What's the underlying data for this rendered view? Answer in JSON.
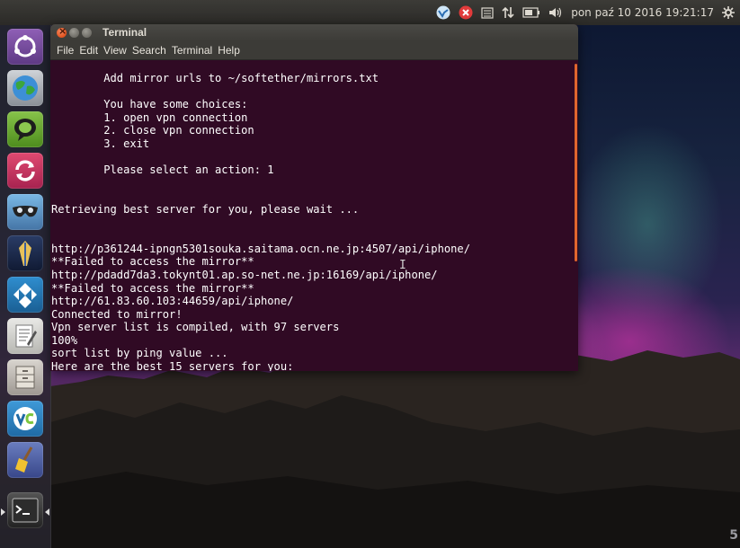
{
  "panel": {
    "tray_icons": [
      "vpn-icon",
      "error-icon",
      "keyboard-icon",
      "network-arrows-icon",
      "battery-icon",
      "volume-icon"
    ],
    "clock": "pon paź 10 2016 19:21:17",
    "settings_icon": "gear-icon"
  },
  "launcher": {
    "items": [
      {
        "name": "dash-icon"
      },
      {
        "name": "globe-browser-icon"
      },
      {
        "name": "chat-bubble-icon"
      },
      {
        "name": "sync-icon"
      },
      {
        "name": "mask-icon"
      },
      {
        "name": "feather-pen-icon"
      },
      {
        "name": "kodi-icon"
      },
      {
        "name": "text-editor-icon"
      },
      {
        "name": "file-cabinet-icon"
      },
      {
        "name": "vnc-icon"
      },
      {
        "name": "broom-icon"
      },
      {
        "name": "terminal-icon"
      }
    ]
  },
  "window": {
    "title": "Terminal",
    "menu": [
      "File",
      "Edit",
      "View",
      "Search",
      "Terminal",
      "Help"
    ]
  },
  "terminal": {
    "lines": [
      "        Add mirror urls to ~/softether/mirrors.txt",
      "",
      "        You have some choices:",
      "        1. open vpn connection",
      "        2. close vpn connection",
      "        3. exit",
      "",
      "        Please select an action: 1",
      "",
      "",
      "Retrieving best server for you, please wait ...",
      "",
      "",
      "http://p361244-ipngn5301souka.saitama.ocn.ne.jp:4507/api/iphone/",
      "**Failed to access the mirror**",
      "http://pdadd7da3.tokynt01.ap.so-net.ne.jp:16169/api/iphone/",
      "**Failed to access the mirror**",
      "http://61.83.60.103:44659/api/iphone/",
      "Connected to mirror!",
      "Vpn server list is compiled, with 97 servers",
      "100%",
      "sort list by ping value ...",
      "Here are the best 15 servers for you:"
    ]
  },
  "corner_text": "5"
}
